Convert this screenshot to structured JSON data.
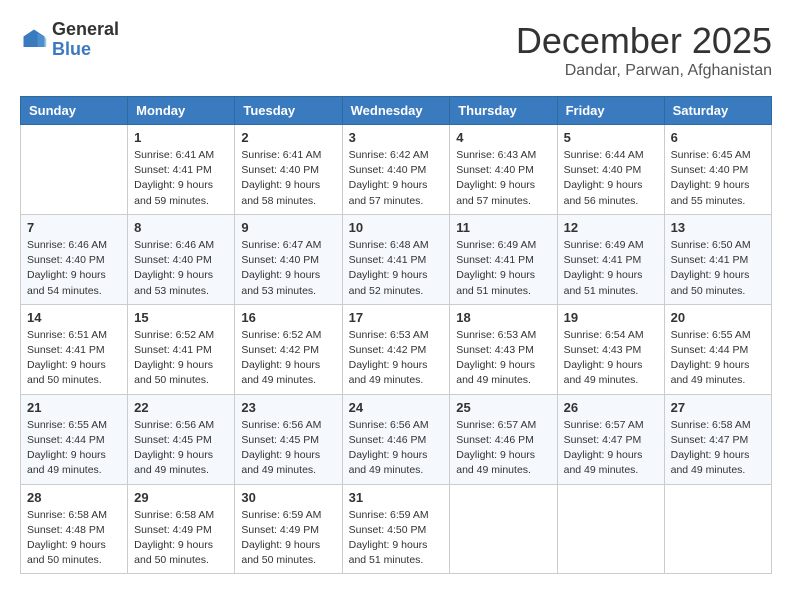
{
  "header": {
    "logo_general": "General",
    "logo_blue": "Blue",
    "month_title": "December 2025",
    "subtitle": "Dandar, Parwan, Afghanistan"
  },
  "days_of_week": [
    "Sunday",
    "Monday",
    "Tuesday",
    "Wednesday",
    "Thursday",
    "Friday",
    "Saturday"
  ],
  "weeks": [
    [
      {
        "day": "",
        "sunrise": "",
        "sunset": "",
        "daylight": ""
      },
      {
        "day": "1",
        "sunrise": "Sunrise: 6:41 AM",
        "sunset": "Sunset: 4:41 PM",
        "daylight": "Daylight: 9 hours and 59 minutes."
      },
      {
        "day": "2",
        "sunrise": "Sunrise: 6:41 AM",
        "sunset": "Sunset: 4:40 PM",
        "daylight": "Daylight: 9 hours and 58 minutes."
      },
      {
        "day": "3",
        "sunrise": "Sunrise: 6:42 AM",
        "sunset": "Sunset: 4:40 PM",
        "daylight": "Daylight: 9 hours and 57 minutes."
      },
      {
        "day": "4",
        "sunrise": "Sunrise: 6:43 AM",
        "sunset": "Sunset: 4:40 PM",
        "daylight": "Daylight: 9 hours and 57 minutes."
      },
      {
        "day": "5",
        "sunrise": "Sunrise: 6:44 AM",
        "sunset": "Sunset: 4:40 PM",
        "daylight": "Daylight: 9 hours and 56 minutes."
      },
      {
        "day": "6",
        "sunrise": "Sunrise: 6:45 AM",
        "sunset": "Sunset: 4:40 PM",
        "daylight": "Daylight: 9 hours and 55 minutes."
      }
    ],
    [
      {
        "day": "7",
        "sunrise": "Sunrise: 6:46 AM",
        "sunset": "Sunset: 4:40 PM",
        "daylight": "Daylight: 9 hours and 54 minutes."
      },
      {
        "day": "8",
        "sunrise": "Sunrise: 6:46 AM",
        "sunset": "Sunset: 4:40 PM",
        "daylight": "Daylight: 9 hours and 53 minutes."
      },
      {
        "day": "9",
        "sunrise": "Sunrise: 6:47 AM",
        "sunset": "Sunset: 4:40 PM",
        "daylight": "Daylight: 9 hours and 53 minutes."
      },
      {
        "day": "10",
        "sunrise": "Sunrise: 6:48 AM",
        "sunset": "Sunset: 4:41 PM",
        "daylight": "Daylight: 9 hours and 52 minutes."
      },
      {
        "day": "11",
        "sunrise": "Sunrise: 6:49 AM",
        "sunset": "Sunset: 4:41 PM",
        "daylight": "Daylight: 9 hours and 51 minutes."
      },
      {
        "day": "12",
        "sunrise": "Sunrise: 6:49 AM",
        "sunset": "Sunset: 4:41 PM",
        "daylight": "Daylight: 9 hours and 51 minutes."
      },
      {
        "day": "13",
        "sunrise": "Sunrise: 6:50 AM",
        "sunset": "Sunset: 4:41 PM",
        "daylight": "Daylight: 9 hours and 50 minutes."
      }
    ],
    [
      {
        "day": "14",
        "sunrise": "Sunrise: 6:51 AM",
        "sunset": "Sunset: 4:41 PM",
        "daylight": "Daylight: 9 hours and 50 minutes."
      },
      {
        "day": "15",
        "sunrise": "Sunrise: 6:52 AM",
        "sunset": "Sunset: 4:41 PM",
        "daylight": "Daylight: 9 hours and 50 minutes."
      },
      {
        "day": "16",
        "sunrise": "Sunrise: 6:52 AM",
        "sunset": "Sunset: 4:42 PM",
        "daylight": "Daylight: 9 hours and 49 minutes."
      },
      {
        "day": "17",
        "sunrise": "Sunrise: 6:53 AM",
        "sunset": "Sunset: 4:42 PM",
        "daylight": "Daylight: 9 hours and 49 minutes."
      },
      {
        "day": "18",
        "sunrise": "Sunrise: 6:53 AM",
        "sunset": "Sunset: 4:43 PM",
        "daylight": "Daylight: 9 hours and 49 minutes."
      },
      {
        "day": "19",
        "sunrise": "Sunrise: 6:54 AM",
        "sunset": "Sunset: 4:43 PM",
        "daylight": "Daylight: 9 hours and 49 minutes."
      },
      {
        "day": "20",
        "sunrise": "Sunrise: 6:55 AM",
        "sunset": "Sunset: 4:44 PM",
        "daylight": "Daylight: 9 hours and 49 minutes."
      }
    ],
    [
      {
        "day": "21",
        "sunrise": "Sunrise: 6:55 AM",
        "sunset": "Sunset: 4:44 PM",
        "daylight": "Daylight: 9 hours and 49 minutes."
      },
      {
        "day": "22",
        "sunrise": "Sunrise: 6:56 AM",
        "sunset": "Sunset: 4:45 PM",
        "daylight": "Daylight: 9 hours and 49 minutes."
      },
      {
        "day": "23",
        "sunrise": "Sunrise: 6:56 AM",
        "sunset": "Sunset: 4:45 PM",
        "daylight": "Daylight: 9 hours and 49 minutes."
      },
      {
        "day": "24",
        "sunrise": "Sunrise: 6:56 AM",
        "sunset": "Sunset: 4:46 PM",
        "daylight": "Daylight: 9 hours and 49 minutes."
      },
      {
        "day": "25",
        "sunrise": "Sunrise: 6:57 AM",
        "sunset": "Sunset: 4:46 PM",
        "daylight": "Daylight: 9 hours and 49 minutes."
      },
      {
        "day": "26",
        "sunrise": "Sunrise: 6:57 AM",
        "sunset": "Sunset: 4:47 PM",
        "daylight": "Daylight: 9 hours and 49 minutes."
      },
      {
        "day": "27",
        "sunrise": "Sunrise: 6:58 AM",
        "sunset": "Sunset: 4:47 PM",
        "daylight": "Daylight: 9 hours and 49 minutes."
      }
    ],
    [
      {
        "day": "28",
        "sunrise": "Sunrise: 6:58 AM",
        "sunset": "Sunset: 4:48 PM",
        "daylight": "Daylight: 9 hours and 50 minutes."
      },
      {
        "day": "29",
        "sunrise": "Sunrise: 6:58 AM",
        "sunset": "Sunset: 4:49 PM",
        "daylight": "Daylight: 9 hours and 50 minutes."
      },
      {
        "day": "30",
        "sunrise": "Sunrise: 6:59 AM",
        "sunset": "Sunset: 4:49 PM",
        "daylight": "Daylight: 9 hours and 50 minutes."
      },
      {
        "day": "31",
        "sunrise": "Sunrise: 6:59 AM",
        "sunset": "Sunset: 4:50 PM",
        "daylight": "Daylight: 9 hours and 51 minutes."
      },
      {
        "day": "",
        "sunrise": "",
        "sunset": "",
        "daylight": ""
      },
      {
        "day": "",
        "sunrise": "",
        "sunset": "",
        "daylight": ""
      },
      {
        "day": "",
        "sunrise": "",
        "sunset": "",
        "daylight": ""
      }
    ]
  ]
}
